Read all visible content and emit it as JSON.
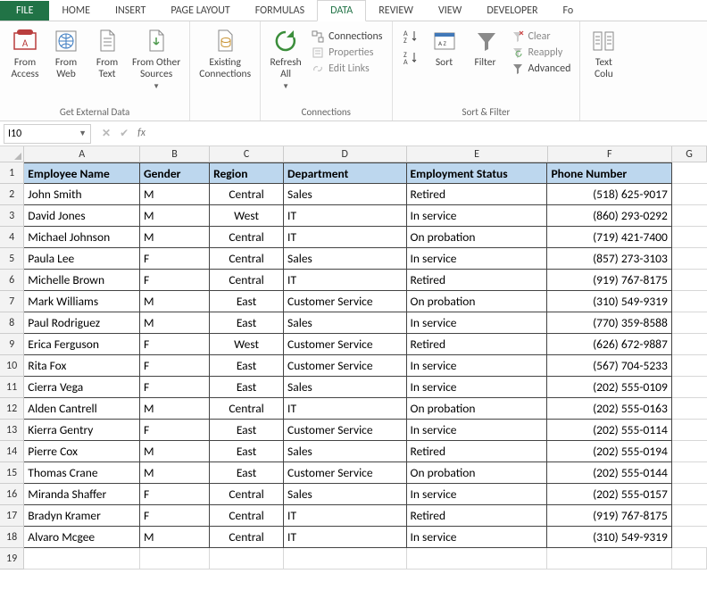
{
  "tabs": {
    "file": "FILE",
    "items": [
      "HOME",
      "INSERT",
      "PAGE LAYOUT",
      "FORMULAS",
      "DATA",
      "REVIEW",
      "VIEW",
      "DEVELOPER"
    ],
    "cut": "Fo",
    "active": "DATA"
  },
  "ribbon": {
    "get_external": {
      "label": "Get External Data",
      "from_access": "From\nAccess",
      "from_web": "From\nWeb",
      "from_text": "From\nText",
      "from_other": "From Other\nSources",
      "existing": "Existing\nConnections"
    },
    "connections": {
      "label": "Connections",
      "refresh": "Refresh\nAll",
      "connections": "Connections",
      "properties": "Properties",
      "edit_links": "Edit Links"
    },
    "sort_filter": {
      "label": "Sort & Filter",
      "sort": "Sort",
      "filter": "Filter",
      "clear": "Clear",
      "reapply": "Reapply",
      "advanced": "Advanced"
    },
    "data_tools": {
      "text_to_columns": "Text\nColu"
    }
  },
  "namebox": {
    "value": "I10"
  },
  "formula": "",
  "columns": [
    "A",
    "B",
    "C",
    "D",
    "E",
    "F",
    "G"
  ],
  "table": {
    "headers": [
      "Employee Name",
      "Gender",
      "Region",
      "Department",
      "Employment Status",
      "Phone Number"
    ],
    "rows": [
      [
        "John Smith",
        "M",
        "Central",
        "Sales",
        "Retired",
        "(518) 625-9017"
      ],
      [
        "David Jones",
        "M",
        "West",
        "IT",
        "In service",
        "(860) 293-0292"
      ],
      [
        "Michael Johnson",
        "M",
        "Central",
        "IT",
        "On probation",
        "(719) 421-7400"
      ],
      [
        "Paula Lee",
        "F",
        "Central",
        "Sales",
        "In service",
        "(857) 273-3103"
      ],
      [
        "Michelle Brown",
        "F",
        "Central",
        "IT",
        "Retired",
        "(919) 767-8175"
      ],
      [
        "Mark Williams",
        "M",
        "East",
        "Customer Service",
        "On probation",
        "(310) 549-9319"
      ],
      [
        "Paul Rodriguez",
        "M",
        "East",
        "Sales",
        "In service",
        "(770) 359-8588"
      ],
      [
        "Erica Ferguson",
        "F",
        "West",
        "Customer Service",
        "Retired",
        "(626) 672-9887"
      ],
      [
        "Rita Fox",
        "F",
        "East",
        "Customer Service",
        "In service",
        "(567) 704-5233"
      ],
      [
        "Cierra Vega",
        "F",
        "East",
        "Sales",
        "In service",
        "(202) 555-0109"
      ],
      [
        "Alden Cantrell",
        "M",
        "Central",
        "IT",
        "On probation",
        "(202) 555-0163"
      ],
      [
        "Kierra Gentry",
        "F",
        "East",
        "Customer Service",
        "In service",
        "(202) 555-0114"
      ],
      [
        "Pierre Cox",
        "M",
        "East",
        "Sales",
        "Retired",
        "(202) 555-0194"
      ],
      [
        "Thomas Crane",
        "M",
        "East",
        "Customer Service",
        "On probation",
        "(202) 555-0144"
      ],
      [
        "Miranda Shaffer",
        "F",
        "Central",
        "Sales",
        "In service",
        "(202) 555-0157"
      ],
      [
        "Bradyn Kramer",
        "F",
        "Central",
        "IT",
        "Retired",
        "(919) 767-8175"
      ],
      [
        "Alvaro Mcgee",
        "M",
        "Central",
        "IT",
        "In service",
        "(310) 549-9319"
      ]
    ]
  }
}
